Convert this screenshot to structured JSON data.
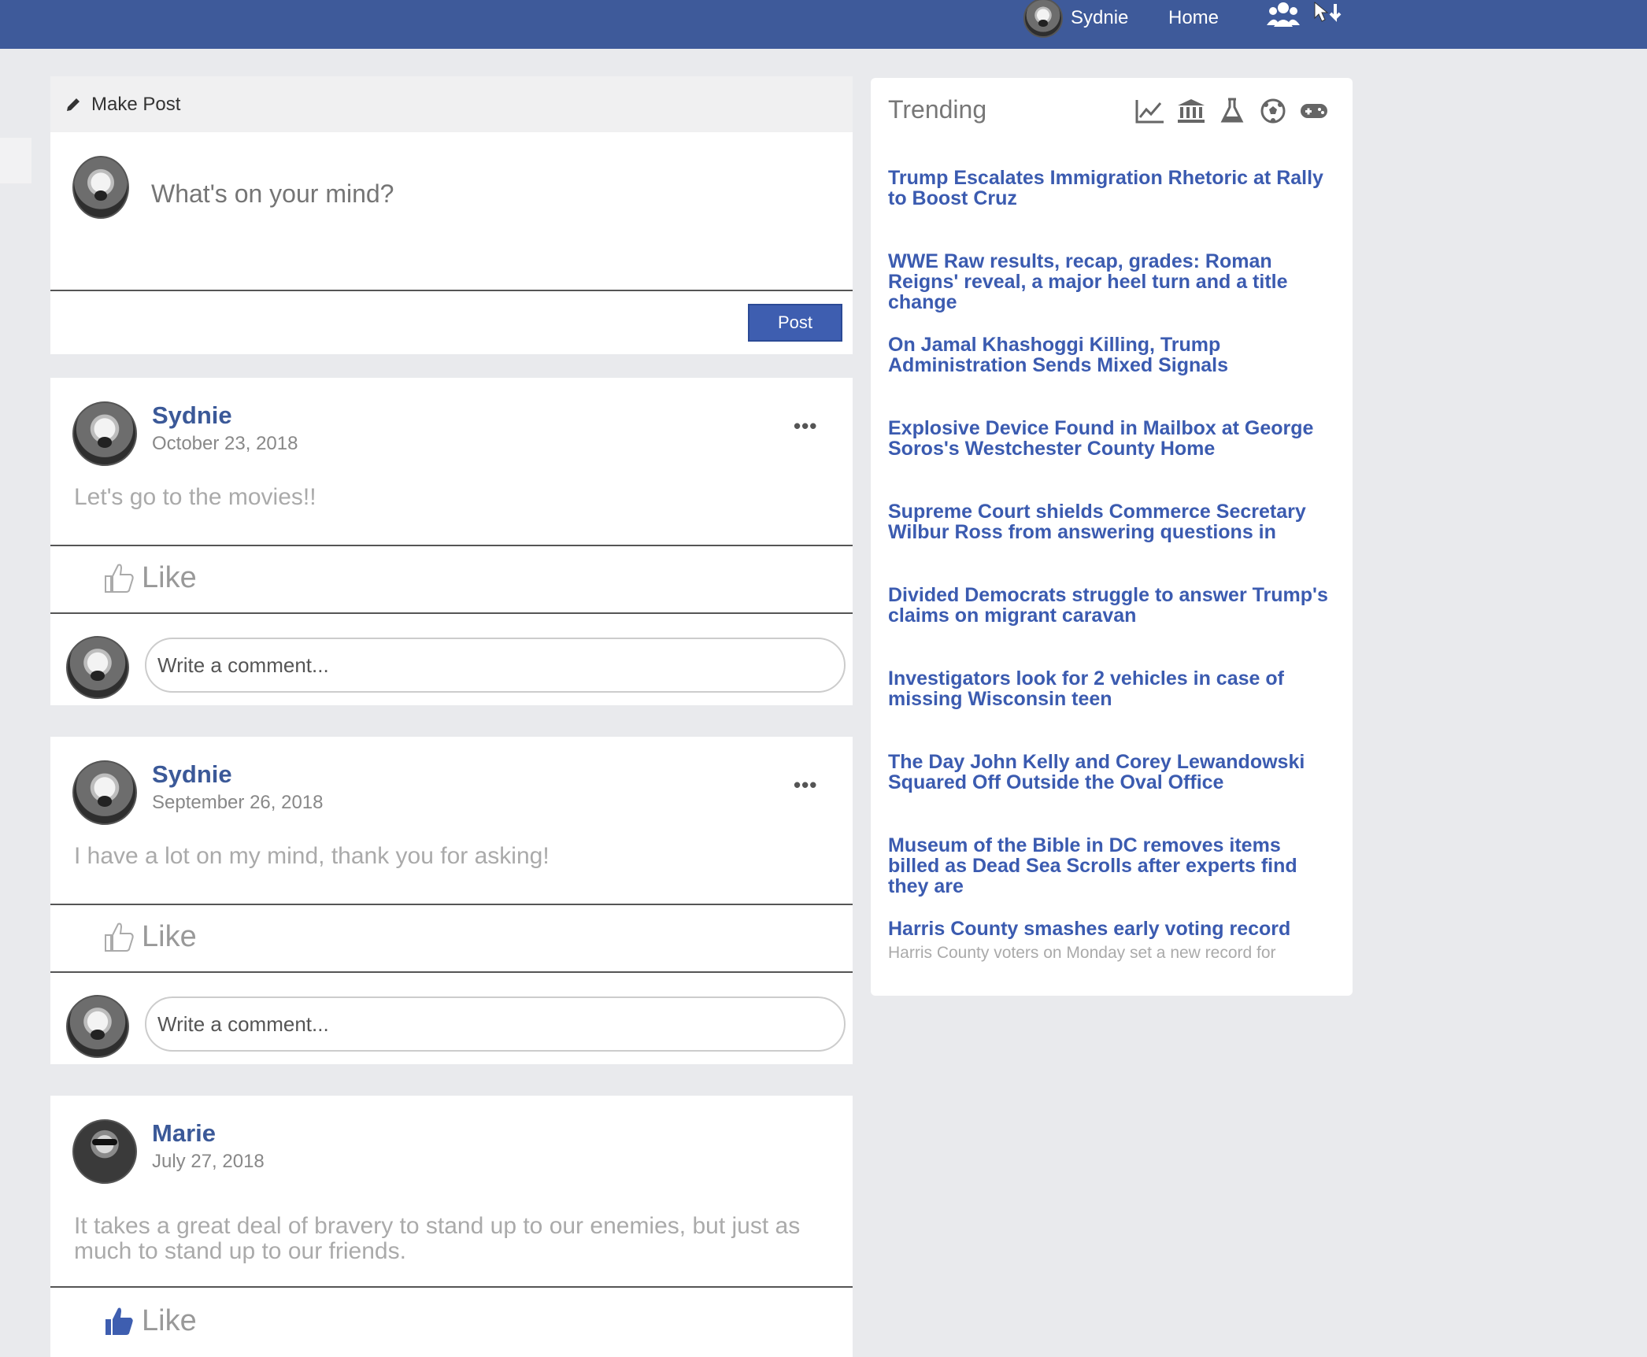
{
  "topbar": {
    "user_name": "Sydnie",
    "home_label": "Home",
    "icons": [
      "friends-icon",
      "cursor-icon"
    ]
  },
  "composer": {
    "title": "Make Post",
    "placeholder": "What's on your mind?",
    "post_label": "Post"
  },
  "posts": [
    {
      "author": "Sydnie",
      "date": "October 23, 2018",
      "text": "Let's go to the movies!!",
      "like_label": "Like",
      "liked": false,
      "comment_placeholder": "Write a comment..."
    },
    {
      "author": "Sydnie",
      "date": "September 26, 2018",
      "text": "I have a lot on my mind, thank you for asking!",
      "like_label": "Like",
      "liked": false,
      "comment_placeholder": "Write a comment..."
    },
    {
      "author": "Marie",
      "date": "July 27, 2018",
      "text": "It takes a great deal of bravery to stand up to our enemies, but just as much to stand up to our friends.",
      "like_label": "Like",
      "liked": true
    }
  ],
  "trending": {
    "title": "Trending",
    "category_icons": [
      "chart-icon",
      "bank-icon",
      "flask-icon",
      "soccer-ball-icon",
      "gamepad-icon"
    ],
    "headlines": [
      "Trump Escalates Immigration Rhetoric at Rally to Boost Cruz",
      "WWE Raw results, recap, grades: Roman Reigns' reveal, a major heel turn and a title change",
      "On Jamal Khashoggi Killing, Trump Administration Sends Mixed Signals",
      "Explosive Device Found in Mailbox at George Soros's Westchester County Home",
      "Supreme Court shields Commerce Secretary Wilbur Ross from answering questions in",
      "Divided Democrats struggle to answer Trump's claims on migrant caravan",
      "Investigators look for 2 vehicles in case of missing Wisconsin teen",
      "The Day John Kelly and Corey Lewandowski Squared Off Outside the Oval Office",
      "Museum of the Bible in DC removes items billed as Dead Sea Scrolls after experts find they are",
      "Harris County smashes early voting record"
    ],
    "last_snippet": "Harris County voters on Monday set a new record for"
  },
  "colors": {
    "topbar": "#3e5a9a",
    "link": "#3b5bb0",
    "background": "#e9eaed",
    "post_button": "#3e5eb0"
  }
}
